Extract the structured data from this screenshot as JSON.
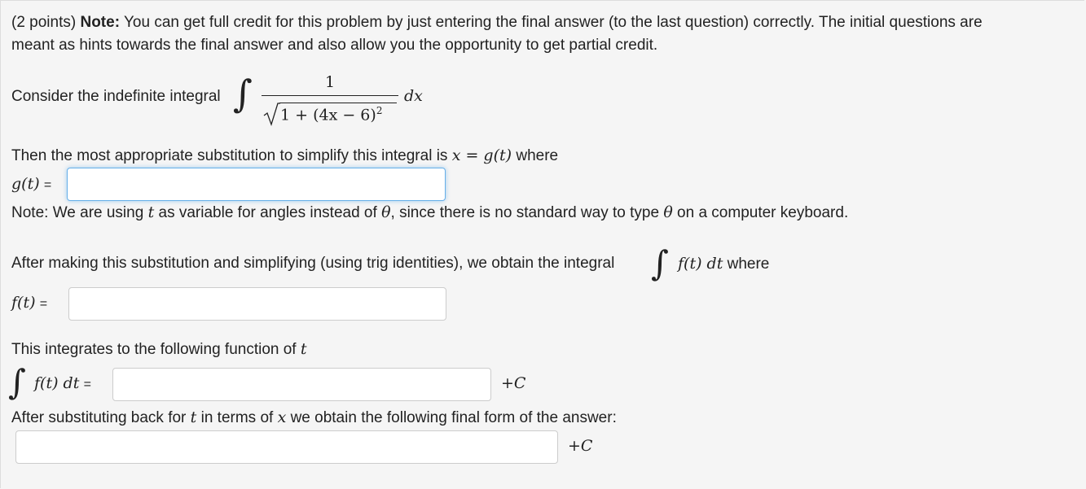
{
  "intro": {
    "points": "(2 points)",
    "note_label": "Note:",
    "line1_rest": "You can get full credit for this problem by just entering the final answer (to the last question) correctly. The initial questions are",
    "line2": "meant as hints towards the final answer and also allow you the opportunity to get partial credit."
  },
  "integral": {
    "prefix": "Consider the indefinite integral",
    "numerator": "1",
    "radicand": "1 + (4x − 6)",
    "exponent": "2",
    "dx": "dx"
  },
  "substitution": {
    "text_before": "Then the most appropriate substitution to simplify this integral is",
    "equation": "x = g(t)",
    "text_after": "where",
    "label": "g(t)",
    "equals": "=",
    "value": ""
  },
  "angle_note": {
    "part1": "Note: We are using",
    "t": "t",
    "part2": "as variable for angles instead of",
    "theta1": "θ",
    "part3": ", since there is no standard way to type",
    "theta2": "θ",
    "part4": "on a computer keyboard."
  },
  "after_sub": {
    "text": "After making this substitution and simplifying (using trig identities), we obtain the integral",
    "integrand": "f(t) dt",
    "where": "where",
    "label": "f(t)",
    "equals": "=",
    "value": ""
  },
  "integrates": {
    "text": "This integrates to the following function of",
    "t": "t",
    "label": "f(t) dt",
    "equals": "=",
    "value": "",
    "plus_c": "+C"
  },
  "final": {
    "part1": "After substituting back for",
    "t": "t",
    "part2": "in terms of",
    "x": "x",
    "part3": "we obtain the following final form of the answer:",
    "value": "",
    "plus_c": "+C"
  }
}
